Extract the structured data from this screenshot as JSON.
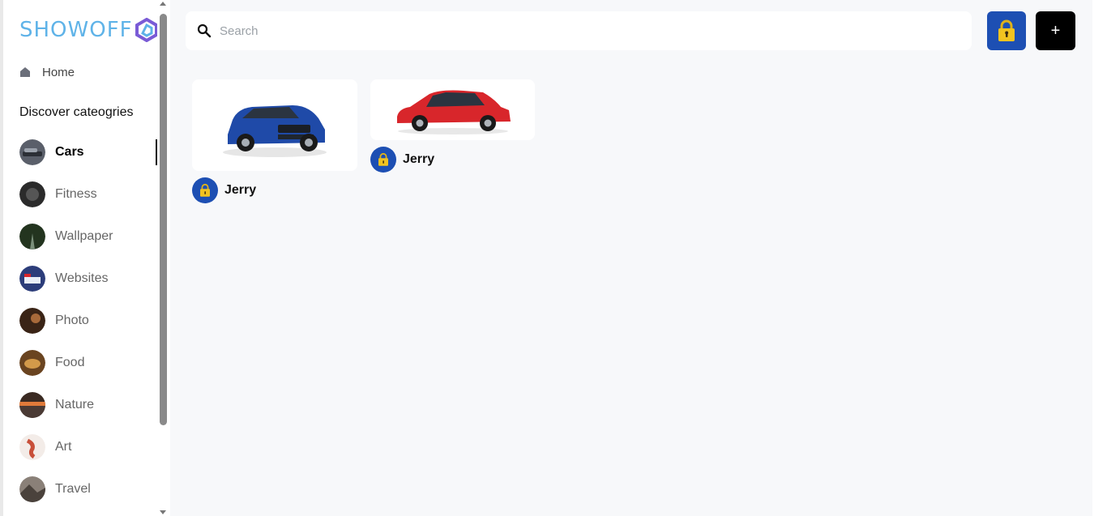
{
  "app": {
    "logo_text": "SHOWOFF"
  },
  "nav": {
    "home_label": "Home"
  },
  "sidebar": {
    "section_title": "Discover cateogries",
    "categories": [
      {
        "label": "Cars",
        "active": true,
        "color": "#5a5f6a"
      },
      {
        "label": "Fitness",
        "active": false,
        "color": "#2b2b2b"
      },
      {
        "label": "Wallpaper",
        "active": false,
        "color": "#3e5a3c"
      },
      {
        "label": "Websites",
        "active": false,
        "color": "#2c3d7a"
      },
      {
        "label": "Photo",
        "active": false,
        "color": "#5b3a24"
      },
      {
        "label": "Food",
        "active": false,
        "color": "#8a5a2a"
      },
      {
        "label": "Nature",
        "active": false,
        "color": "#7a4a30"
      },
      {
        "label": "Art",
        "active": false,
        "color": "#c8503a"
      },
      {
        "label": "Travel",
        "active": false,
        "color": "#6a6a6a"
      }
    ]
  },
  "search": {
    "placeholder": "Search",
    "value": ""
  },
  "toolbar": {
    "add_label": "+"
  },
  "pins": [
    {
      "author": "Jerry",
      "car_color": "#1f4aa8"
    },
    {
      "author": "Jerry",
      "car_color": "#d8262b"
    }
  ],
  "colors": {
    "accent_blue": "#1d4fb3",
    "lock_yellow": "#f2c320",
    "logo_blue": "#5fb3e8",
    "logo_purple": "#7a5bd6"
  }
}
